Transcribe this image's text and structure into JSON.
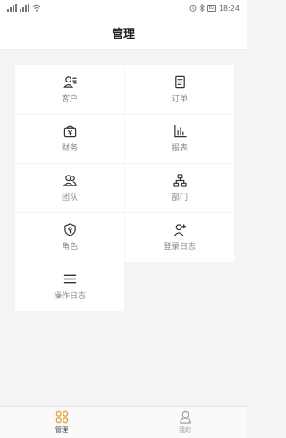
{
  "status_bar": {
    "time": "18:24",
    "battery": "82"
  },
  "header": {
    "title": "管理"
  },
  "menu": {
    "items": [
      {
        "label": "客户",
        "icon": "customer-icon"
      },
      {
        "label": "订单",
        "icon": "order-icon"
      },
      {
        "label": "财务",
        "icon": "finance-icon"
      },
      {
        "label": "报表",
        "icon": "report-icon"
      },
      {
        "label": "团队",
        "icon": "team-icon"
      },
      {
        "label": "部门",
        "icon": "department-icon"
      },
      {
        "label": "角色",
        "icon": "role-icon"
      },
      {
        "label": "登录日志",
        "icon": "login-log-icon"
      },
      {
        "label": "操作日志",
        "icon": "operation-log-icon"
      }
    ]
  },
  "tab_bar": {
    "tabs": [
      {
        "label": "管理",
        "icon": "grid-icon",
        "active": true,
        "active_color": "#e6a23c"
      },
      {
        "label": "我的",
        "icon": "user-icon",
        "active": false
      }
    ]
  },
  "colors": {
    "accent": "#e6a23c",
    "icon": "#333333",
    "label": "#888888",
    "background": "#f4f4f4"
  }
}
